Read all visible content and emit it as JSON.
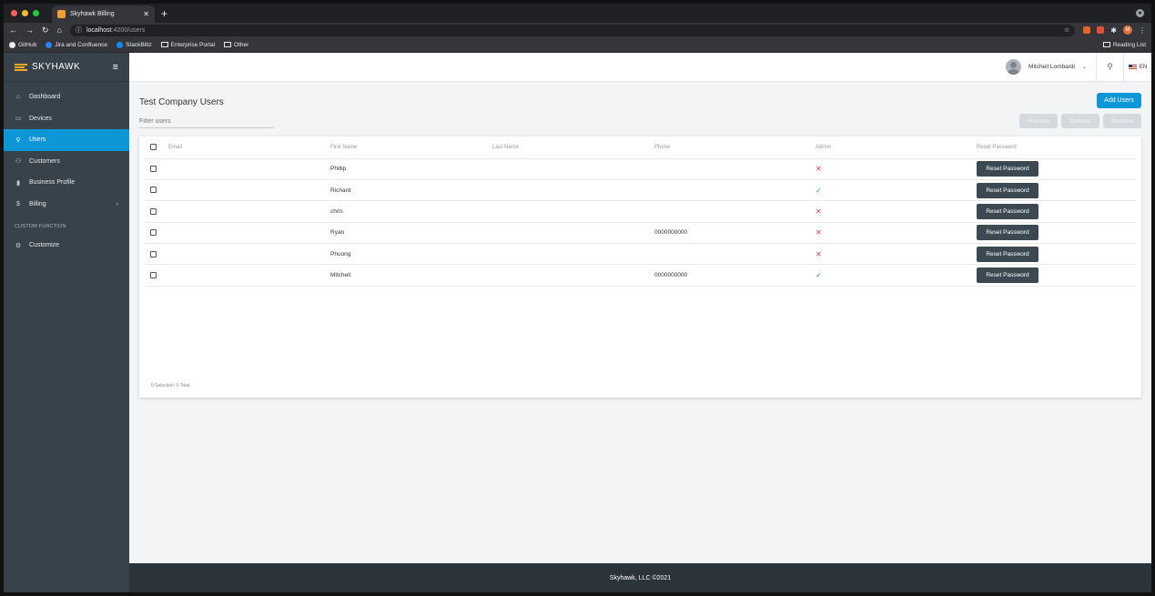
{
  "browser": {
    "tab_title": "Skyhawk Billing",
    "url_host": "localhost",
    "url_path": ":4200/users",
    "profile_letter": "M",
    "bookmarks": [
      "GitHub",
      "Jira and Confluence",
      "StackBlitz",
      "Enterprise Portal",
      "Other"
    ],
    "reading_list": "Reading List"
  },
  "sidebar": {
    "brand": "SKYHAWK",
    "items": [
      {
        "label": "Dashboard",
        "icon": "home-icon"
      },
      {
        "label": "Devices",
        "icon": "laptop-icon"
      },
      {
        "label": "Users",
        "icon": "user-icon"
      },
      {
        "label": "Customers",
        "icon": "users-icon"
      },
      {
        "label": "Business Profile",
        "icon": "building-icon"
      },
      {
        "label": "Billing",
        "icon": "dollar-icon"
      }
    ],
    "section": "CUSTOM FUNCTION",
    "custom_items": [
      {
        "label": "Customize",
        "icon": "gear-icon"
      }
    ]
  },
  "topbar": {
    "user_name": "Mitchell Lombardi",
    "language": "EN"
  },
  "page": {
    "title": "Test Company Users",
    "add_button": "Add Users",
    "filter_placeholder": "Filter users",
    "actions": {
      "promote": "Promote",
      "demote": "Demote",
      "remove": "Remove"
    },
    "columns": [
      "Email",
      "First Name",
      "Last Name",
      "Phone",
      "Admin",
      "Reset Password"
    ],
    "rows": [
      {
        "email": "",
        "first": "Phillip",
        "last": "",
        "phone": "",
        "admin": "✕",
        "reset": "Reset Password"
      },
      {
        "email": "",
        "first": "Richard",
        "last": "",
        "phone": "",
        "admin": "✓",
        "reset": "Reset Password"
      },
      {
        "email": "",
        "first": "chris",
        "last": "",
        "phone": "",
        "admin": "✕",
        "reset": "Reset Password"
      },
      {
        "email": "",
        "first": "Ryan",
        "last": "",
        "phone": "0000000000",
        "admin": "✕",
        "reset": "Reset Password"
      },
      {
        "email": "",
        "first": "Phuong",
        "last": "",
        "phone": "",
        "admin": "✕",
        "reset": "Reset Password"
      },
      {
        "email": "",
        "first": "Mitchell",
        "last": "",
        "phone": "0000000000",
        "admin": "✓",
        "reset": "Reset Password"
      }
    ],
    "selection_summary": "0 Selected / 6 Total"
  },
  "footer": {
    "text": "Skyhawk, LLC ©2021"
  },
  "colors": {
    "accent": "#0d97d6",
    "sidebar": "#37424a",
    "admin_no": "#e53935",
    "admin_yes": "#1e88e5"
  }
}
